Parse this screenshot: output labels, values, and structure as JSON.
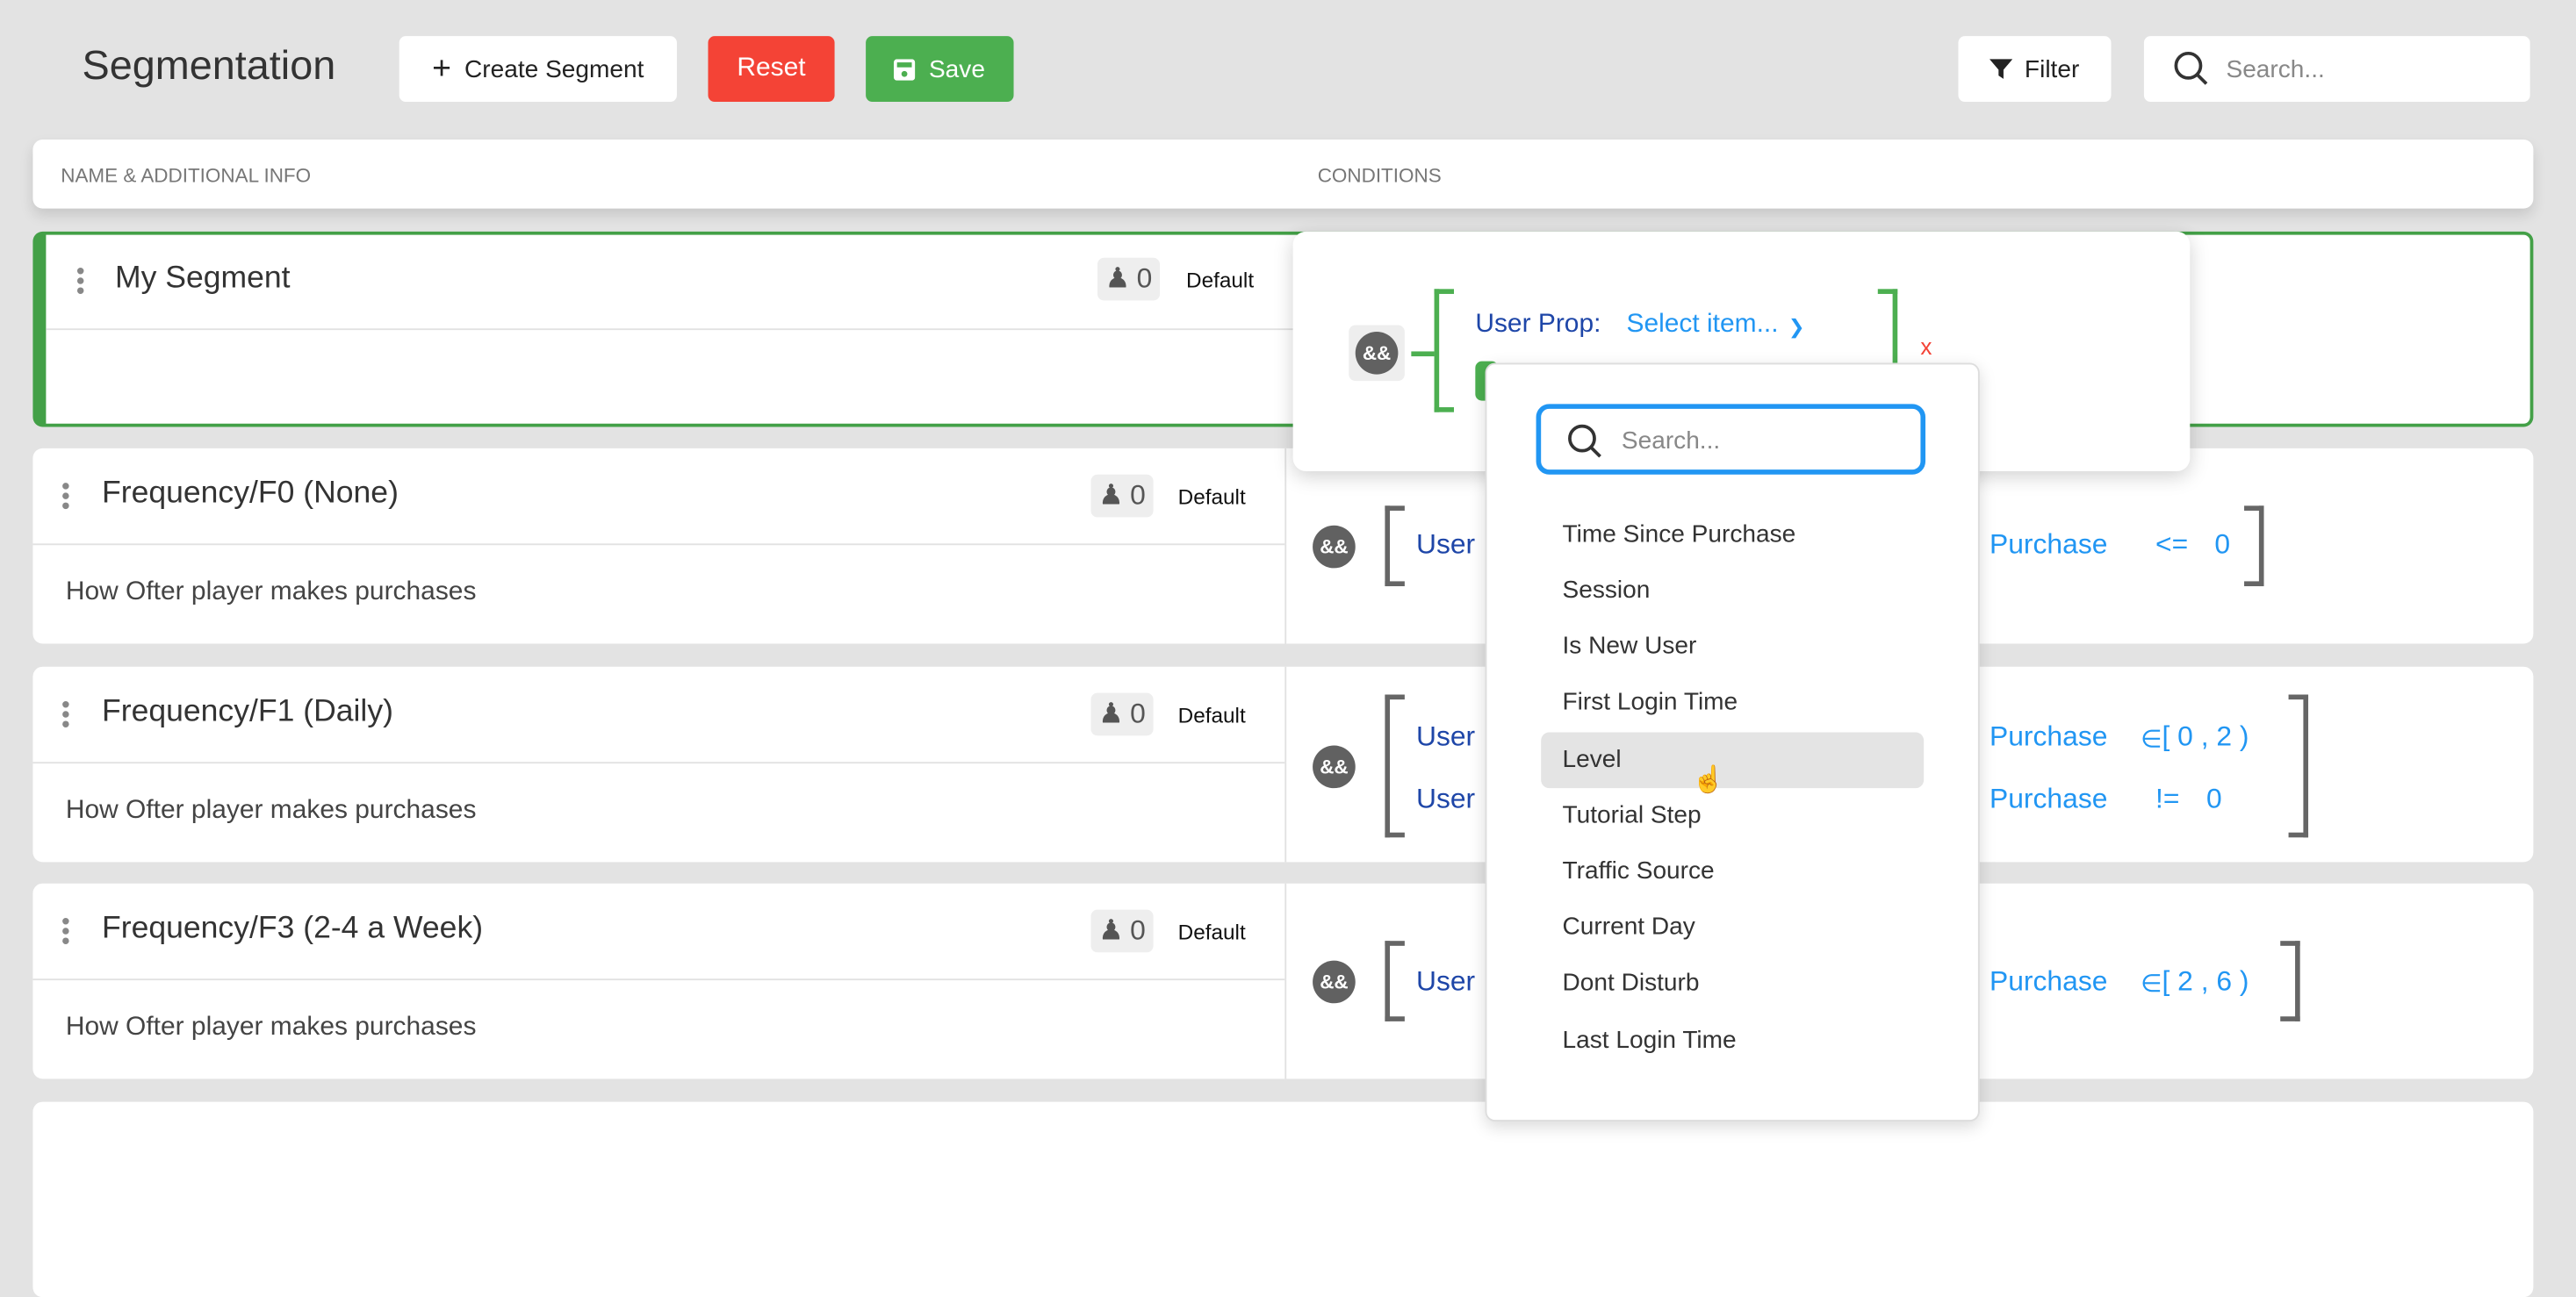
{
  "header": {
    "title": "Segmentation",
    "create_label": "Create Segment",
    "reset_label": "Reset",
    "save_label": "Save",
    "filter_label": "Filter",
    "search_placeholder": "Search..."
  },
  "colors": {
    "reset": "#f44336",
    "save": "#4caf50",
    "accent": "#2196f3",
    "active_border": "#43a047"
  },
  "table": {
    "col_name": "NAME & ADDITIONAL INFO",
    "col_conditions": "CONDITIONS"
  },
  "segments": [
    {
      "name": "My Segment",
      "count": "0",
      "tag": "Default",
      "description": ""
    },
    {
      "name": "Frequency/F0 (None)",
      "count": "0",
      "tag": "Default",
      "description": "How Ofter player makes purchases"
    },
    {
      "name": "Frequency/F1 (Daily)",
      "count": "0",
      "tag": "Default",
      "description": "How Ofter player makes purchases"
    },
    {
      "name": "Frequency/F3 (2-4 a Week)",
      "count": "0",
      "tag": "Default",
      "description": "How Ofter player makes purchases"
    }
  ],
  "conditions": {
    "and_label": "&&",
    "editor": {
      "prop_label": "User Prop:",
      "select_placeholder": "Select item...",
      "remove": "x"
    },
    "row1": {
      "lhs": "User",
      "prop": "Purchase",
      "op": "<=",
      "value": "0"
    },
    "row2": [
      {
        "lhs": "User",
        "prop": "Purchase",
        "op": "∈",
        "range": "[ 0 , 2 )"
      },
      {
        "lhs": "User",
        "prop": "Purchase",
        "op": "!=",
        "value": "0"
      }
    ],
    "row3": {
      "lhs": "User",
      "prop": "Purchase",
      "op": "∈",
      "range": "[ 2 , 6 )"
    }
  },
  "dropdown": {
    "search_placeholder": "Search...",
    "items": [
      "Time Since Purchase",
      "Session",
      "Is New User",
      "First Login Time",
      "Level",
      "Tutorial Step",
      "Traffic Source",
      "Current Day",
      "Dont Disturb",
      "Last Login Time"
    ],
    "highlighted": "Level"
  }
}
